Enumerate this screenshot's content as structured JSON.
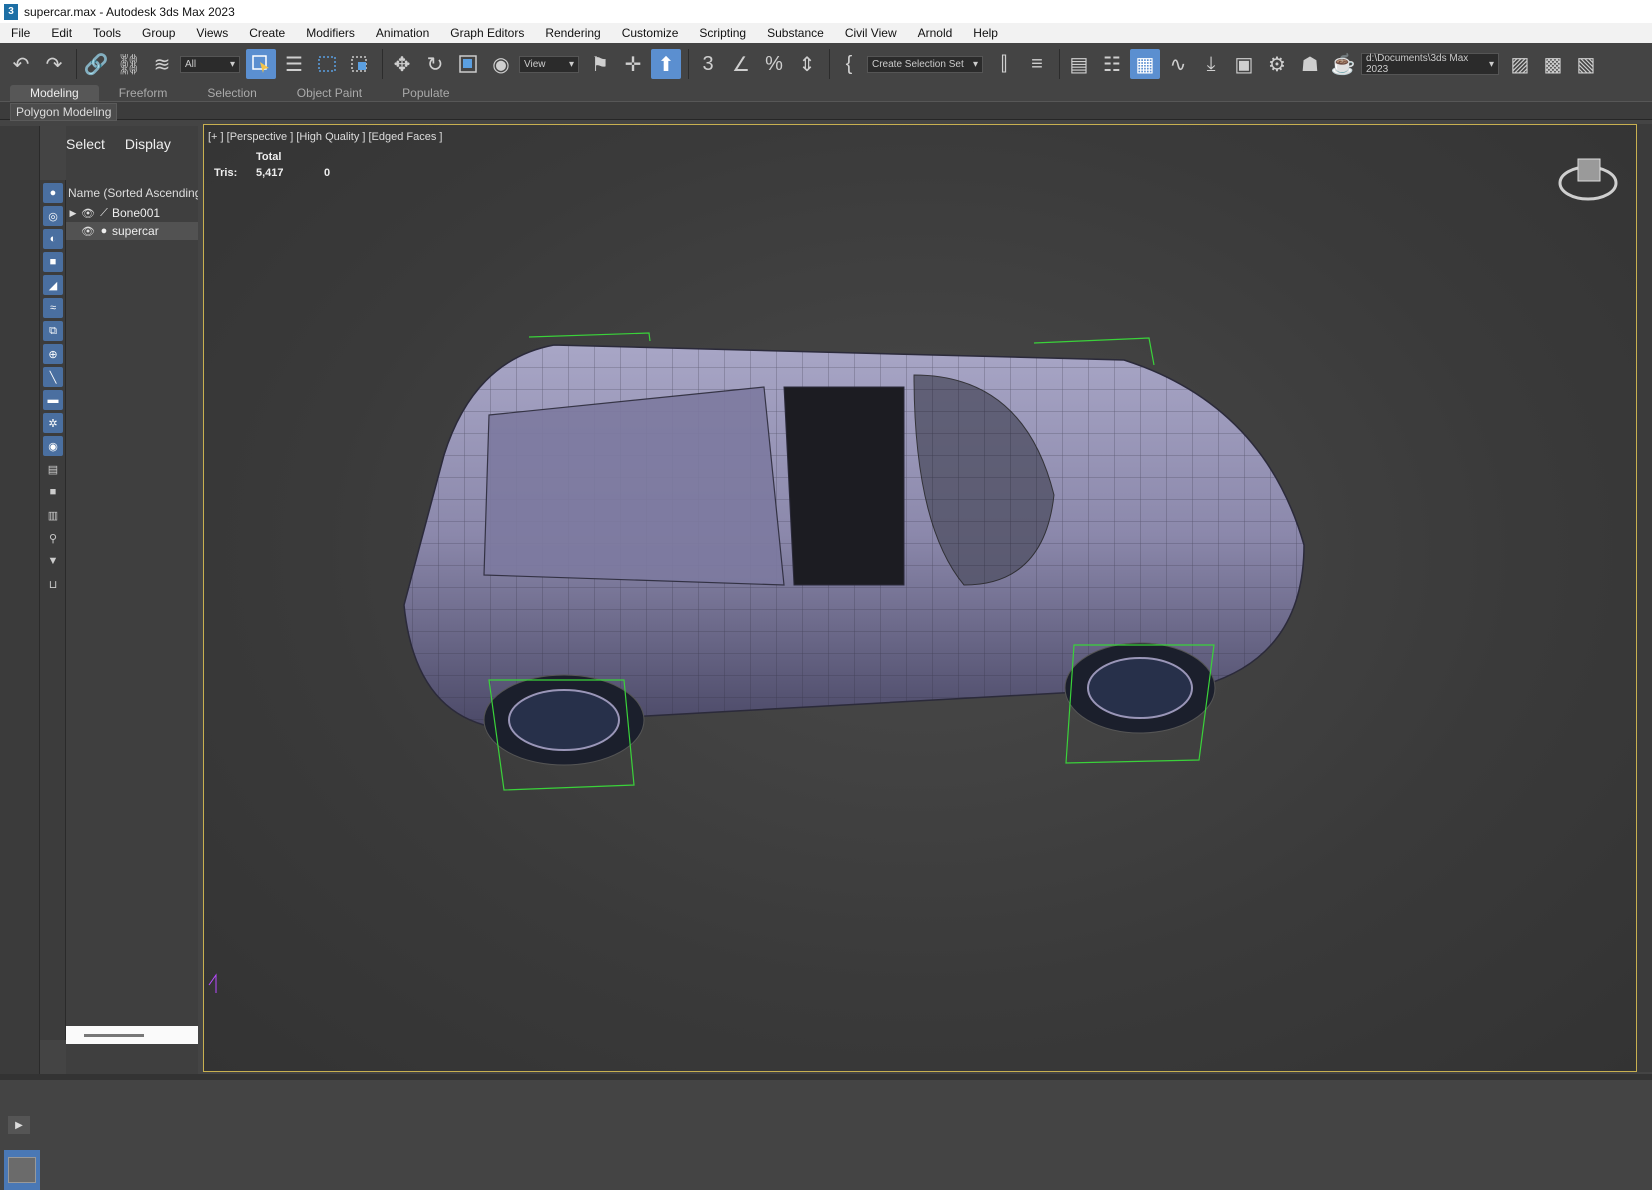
{
  "window": {
    "title": "supercar.max - Autodesk 3ds Max 2023",
    "app_icon": "3"
  },
  "menu": [
    "File",
    "Edit",
    "Tools",
    "Group",
    "Views",
    "Create",
    "Modifiers",
    "Animation",
    "Graph Editors",
    "Rendering",
    "Customize",
    "Scripting",
    "Substance",
    "Civil View",
    "Arnold",
    "Help"
  ],
  "toolbar": {
    "filter_dropdown": "All",
    "ref_coord_dropdown": "View",
    "selection_set_dropdown": "Create Selection Set",
    "project_path": "d:\\Documents\\3ds Max 2023"
  },
  "ribbon": {
    "tabs": [
      "Modeling",
      "Freeform",
      "Selection",
      "Object Paint",
      "Populate"
    ],
    "active_tab": "Modeling",
    "panel_label": "Polygon Modeling"
  },
  "scene_explorer": {
    "tabs": [
      "Select",
      "Display"
    ],
    "column_header": "Name (Sorted Ascending)",
    "items": [
      {
        "name": "Bone001",
        "type": "bone-icon",
        "expandable": true,
        "selected": false
      },
      {
        "name": "supercar",
        "type": "geometry-icon",
        "expandable": false,
        "selected": true
      }
    ]
  },
  "viewport": {
    "label": "[+ ] [Perspective ] [High Quality ] [Edged Faces ]",
    "stats": {
      "header": "Total",
      "label": "Tris:",
      "value": "5,417",
      "selected": "0"
    }
  }
}
